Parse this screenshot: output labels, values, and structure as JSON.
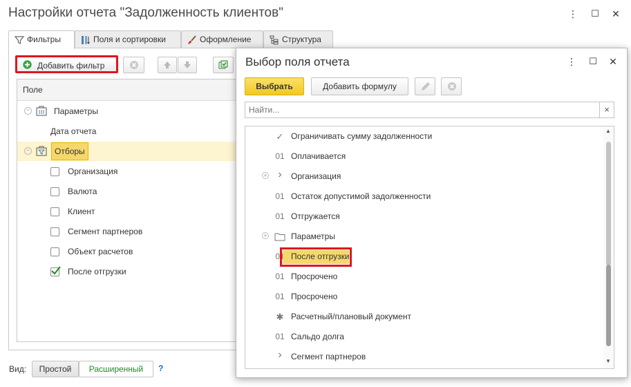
{
  "window": {
    "title": "Настройки отчета \"Задолженность клиентов\"",
    "menu_icon": "⋮",
    "maximize_icon": "☐",
    "close_icon": "✕"
  },
  "tabs": [
    {
      "label": "Фильтры",
      "icon": "filter-icon"
    },
    {
      "label": "Поля и сортировки",
      "icon": "columns-icon"
    },
    {
      "label": "Оформление",
      "icon": "brush-icon"
    },
    {
      "label": "Структура",
      "icon": "structure-icon"
    }
  ],
  "toolbar": {
    "add_filter_label": "Добавить фильтр"
  },
  "grid": {
    "header": "Поле",
    "parameters_label": "Параметры",
    "report_date_label": "Дата отчета",
    "filters_label": "Отборы",
    "filter_items": [
      {
        "label": "Организация",
        "checked": false
      },
      {
        "label": "Валюта",
        "checked": false
      },
      {
        "label": "Клиент",
        "checked": false
      },
      {
        "label": "Сегмент партнеров",
        "checked": false
      },
      {
        "label": "Объект расчетов",
        "checked": false
      },
      {
        "label": "После отгрузки",
        "checked": true
      }
    ]
  },
  "footer": {
    "view_label": "Вид:",
    "simple_label": "Простой",
    "extended_label": "Расширенный",
    "help_label": "?"
  },
  "dialog": {
    "title": "Выбор поля отчета",
    "select_label": "Выбрать",
    "add_formula_label": "Добавить формулу",
    "search_placeholder": "Найти...",
    "search_clear": "×",
    "items": [
      {
        "icon": "✓",
        "label": "Ограничивать сумму задолженности",
        "expandable": false,
        "highlighted": false
      },
      {
        "icon": "01",
        "label": "Оплачивается",
        "expandable": false,
        "highlighted": false
      },
      {
        "icon": "›",
        "label": "Организация",
        "expandable": true,
        "highlighted": false
      },
      {
        "icon": "01",
        "label": "Остаток допустимой задолженности",
        "expandable": false,
        "highlighted": false
      },
      {
        "icon": "01",
        "label": "Отгружается",
        "expandable": false,
        "highlighted": false
      },
      {
        "icon": "folder",
        "label": "Параметры",
        "expandable": true,
        "highlighted": false
      },
      {
        "icon": "01",
        "label": "После отгрузки",
        "expandable": false,
        "highlighted": true
      },
      {
        "icon": "01",
        "label": "Просрочено",
        "expandable": false,
        "highlighted": false
      },
      {
        "icon": "01",
        "label": "Просрочено",
        "expandable": false,
        "highlighted": false
      },
      {
        "icon": "✱",
        "label": "Расчетный/плановый документ",
        "expandable": false,
        "highlighted": false
      },
      {
        "icon": "01",
        "label": "Сальдо долга",
        "expandable": false,
        "highlighted": false
      },
      {
        "icon": "›",
        "label": "Сегмент партнеров",
        "expandable": false,
        "highlighted": false
      }
    ]
  },
  "colors": {
    "accent_yellow": "#f6d33c",
    "highlight_red": "#e0151c",
    "selected_row": "#fdf4d0",
    "green_add": "#3aa63a",
    "green_text": "#1f8a1f"
  }
}
